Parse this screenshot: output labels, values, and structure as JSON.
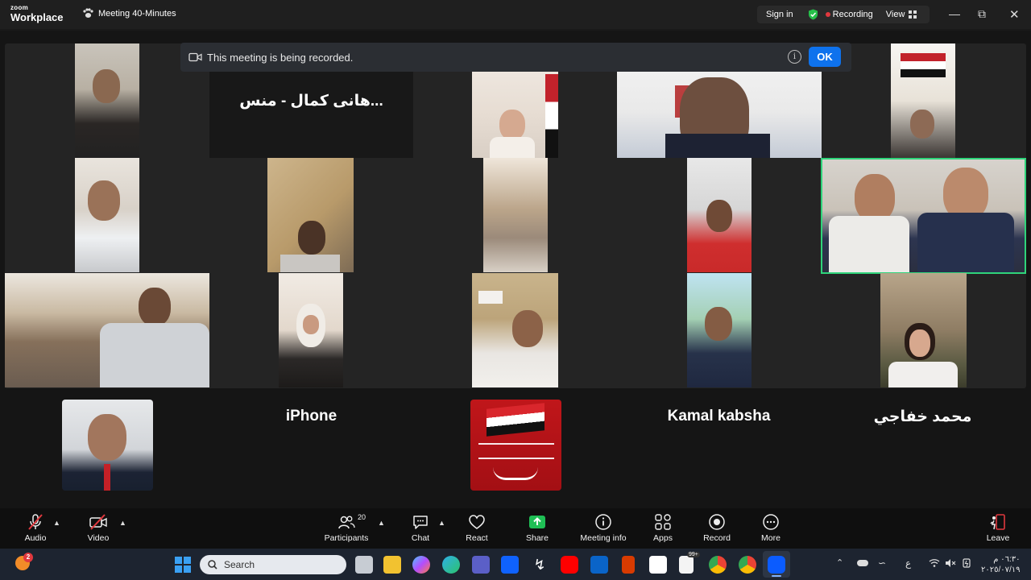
{
  "app": {
    "brand_small": "zoom",
    "brand_large": "Workplace",
    "meeting_title": "Meeting 40-Minutes"
  },
  "titlebar": {
    "sign_in": "Sign in",
    "recording": "Recording",
    "view": "View"
  },
  "banner": {
    "text": "This meeting is being recorded.",
    "ok": "OK"
  },
  "participants": {
    "name_tile_hani": "...هانى كمال - منس",
    "bottom_names": [
      "iPhone",
      "Kamal kabsha",
      "محمد خفاجي"
    ]
  },
  "toolbar": {
    "audio": "Audio",
    "video": "Video",
    "participants": "Participants",
    "participants_count": "20",
    "chat": "Chat",
    "react": "React",
    "share": "Share",
    "meeting_info": "Meeting info",
    "apps": "Apps",
    "record": "Record",
    "more": "More",
    "leave": "Leave"
  },
  "taskbar": {
    "search_placeholder": "Search",
    "notif_badge": "2",
    "clock_time": "٠٦:٣٠ م",
    "clock_date": "٢٠٢٥/٠٧/١٩",
    "ime": "ع",
    "badge_99": "99+"
  },
  "colors": {
    "active_speaker": "#2fd47a",
    "ok_button": "#0e72ed",
    "recording_dot": "#e0383e",
    "share_green": "#1fbf55"
  }
}
